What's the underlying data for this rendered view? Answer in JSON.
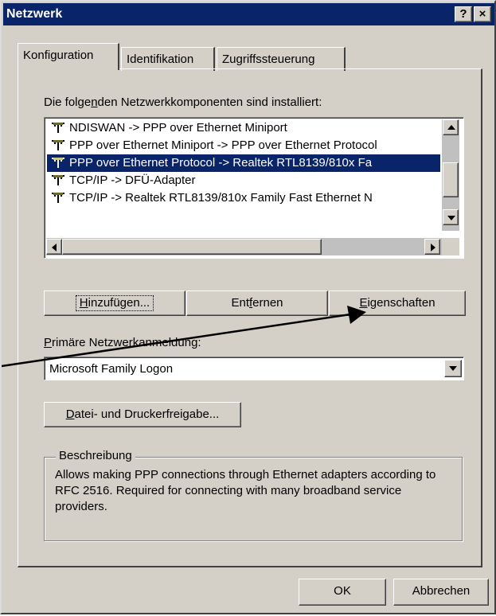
{
  "window": {
    "title": "Netzwerk",
    "help_label": "?",
    "close_label": "×"
  },
  "tabs": [
    {
      "label": "Konfiguration",
      "active": true
    },
    {
      "label": "Identifikation",
      "active": false
    },
    {
      "label": "Zugriffssteuerung",
      "active": false
    }
  ],
  "components": {
    "label_prefix": "Die folge",
    "label_accel": "n",
    "label_suffix": "den Netzwerkkomponenten sind installiert:",
    "items": [
      {
        "text": "NDISWAN -> PPP over Ethernet Miniport",
        "selected": false
      },
      {
        "text": "PPP over Ethernet Miniport -> PPP over Ethernet Protocol",
        "selected": false
      },
      {
        "text": "PPP over Ethernet Protocol -> Realtek RTL8139/810x Fa",
        "selected": true
      },
      {
        "text": "TCP/IP -> DFÜ-Adapter",
        "selected": false
      },
      {
        "text": "TCP/IP -> Realtek RTL8139/810x Family Fast Ethernet N",
        "selected": false
      }
    ],
    "icon": "network-adapter-icon"
  },
  "buttons": {
    "add": {
      "accel": "H",
      "rest": "inzufügen..."
    },
    "remove": {
      "prefix": "Ent",
      "accel": "f",
      "rest": "ernen"
    },
    "properties": {
      "accel": "E",
      "rest": "igenschaften"
    },
    "file_print": {
      "accel": "D",
      "rest": "atei- und Druckerfreigabe..."
    },
    "ok": "OK",
    "cancel": "Abbrechen"
  },
  "logon": {
    "label_accel": "P",
    "label_rest": "rimäre Netzwerkanmeldung:",
    "selected": "Microsoft Family Logon"
  },
  "description": {
    "title": "Beschreibung",
    "text": "Allows making PPP connections through Ethernet adapters according to RFC 2516. Required for connecting with many broadband service providers."
  },
  "colors": {
    "dialog_bg": "#d4d0c8",
    "titlebar": "#0a246a",
    "selection": "#0a246a",
    "annotation_arrow": "#000000"
  }
}
